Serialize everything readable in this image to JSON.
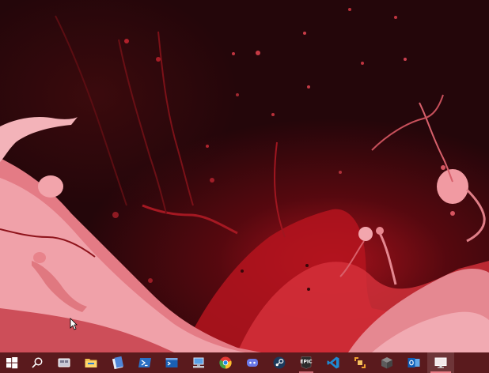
{
  "desktop": {
    "wallpaper": "red-liquid-splash",
    "colors": {
      "background": "#20060a",
      "splash_light": "#f2a4ac",
      "splash_mid": "#d9545f",
      "splash_dark": "#9c0f1a",
      "taskbar": "#5a1a1d"
    }
  },
  "taskbar": {
    "items": [
      {
        "icon": "windows-start-icon"
      },
      {
        "icon": "search-icon"
      },
      {
        "icon": "task-view-icon"
      },
      {
        "icon": "file-explorer-icon"
      },
      {
        "icon": "notepad-icon"
      },
      {
        "icon": "powershell-icon"
      },
      {
        "icon": "terminal-icon"
      },
      {
        "icon": "network-computer-icon"
      },
      {
        "icon": "chrome-icon"
      },
      {
        "icon": "discord-icon"
      },
      {
        "icon": "steam-icon"
      },
      {
        "icon": "epic-games-icon",
        "label": "EPIC"
      },
      {
        "icon": "vscode-icon"
      },
      {
        "icon": "remote-desktop-icon"
      },
      {
        "icon": "package-box-icon"
      },
      {
        "icon": "outlook-icon"
      },
      {
        "icon": "monitor-app-icon"
      }
    ]
  }
}
